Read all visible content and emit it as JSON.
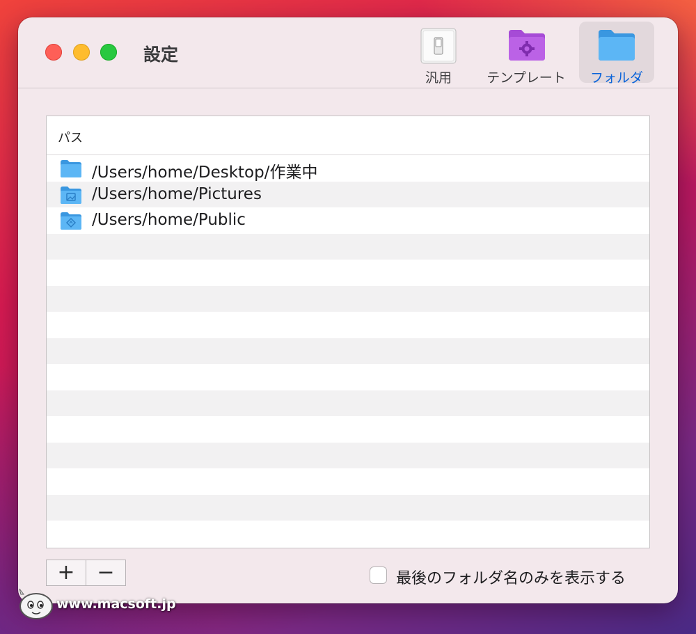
{
  "window": {
    "title": "設定"
  },
  "toolbar": {
    "items": [
      {
        "label": "汎用",
        "icon": "switch-icon"
      },
      {
        "label": "テンプレート",
        "icon": "template-folder-icon"
      },
      {
        "label": "フォルダ",
        "icon": "folder-icon",
        "selected": true
      }
    ]
  },
  "table": {
    "column_header": "パス",
    "rows": [
      {
        "path": "/Users/home/Desktop/作業中",
        "icon": "folder-icon"
      },
      {
        "path": "/Users/home/Pictures",
        "icon": "pictures-folder-icon"
      },
      {
        "path": "/Users/home/Public",
        "icon": "public-folder-icon"
      }
    ]
  },
  "controls": {
    "add_label": "+",
    "remove_label": "−",
    "checkbox_label": "最後のフォルダ名のみを表示する",
    "checkbox_checked": false
  },
  "watermark": {
    "text": "www.macsoft.jp"
  },
  "colors": {
    "accent": "#0a63d9",
    "template_purple": "#a64bd6",
    "folder_blue": "#4aa8f0"
  }
}
